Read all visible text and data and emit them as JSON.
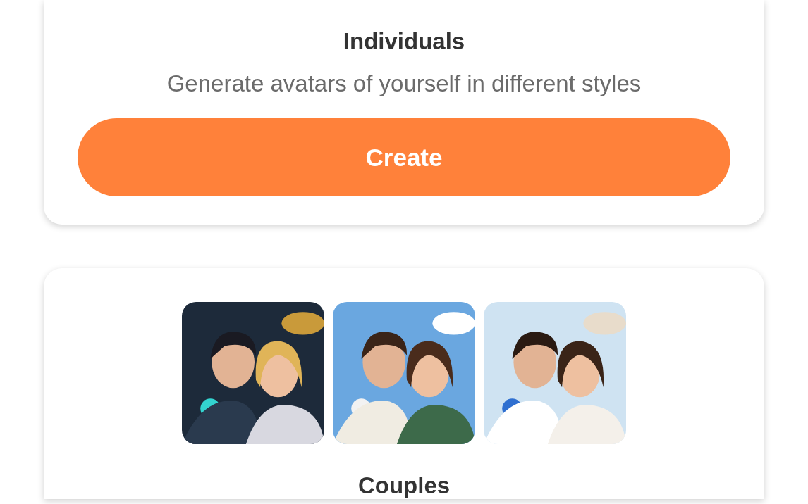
{
  "cards": [
    {
      "title": "Individuals",
      "description": "Generate avatars of yourself in different styles",
      "button": "Create"
    },
    {
      "title": "Couples"
    }
  ]
}
